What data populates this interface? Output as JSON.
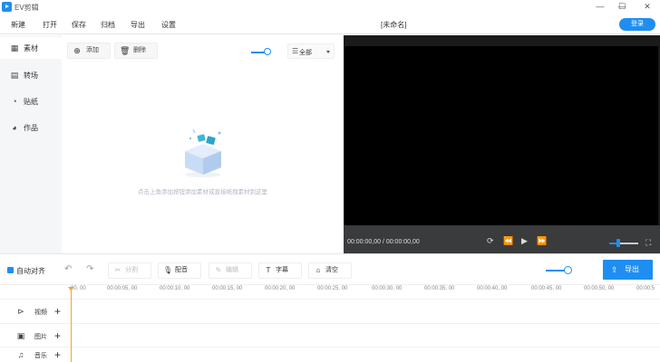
{
  "window": {
    "title": "EV剪辑",
    "controls": {
      "minimize": "—",
      "maximize": "☐",
      "close": "✕"
    }
  },
  "menu": {
    "items": [
      "新建",
      "打开",
      "保存",
      "归档",
      "导出",
      "设置"
    ],
    "doc_title": "[未命名]",
    "login_label": "登录"
  },
  "sidebar": {
    "items": [
      {
        "label": "素材",
        "icon": "grid-icon",
        "active": true
      },
      {
        "label": "转场",
        "icon": "film-icon",
        "active": false
      },
      {
        "label": "贴纸",
        "icon": "sticker-icon",
        "active": false
      },
      {
        "label": "作品",
        "icon": "pie-icon",
        "active": false
      }
    ]
  },
  "library": {
    "add_label": "添加",
    "delete_label": "删除",
    "filter_value": "全部",
    "empty_hint": "点击上角添加按钮添加素材或直接拖拽素材到这里"
  },
  "preview": {
    "time": "00:00:00,00 / 00:00:00,00"
  },
  "timeline": {
    "auto_align_label": "自动对齐",
    "split_label": "分割",
    "dub_label": "配音",
    "edit_label": "编辑",
    "subtitle_label": "字幕",
    "clear_label": "清空",
    "export_label": "导出",
    "ruler_ticks": [
      "00, 00",
      "00:00:05, 00",
      "00:00:10, 00",
      "00:00:15, 00",
      "00:00:20, 00",
      "00:00:25, 00",
      "00:00:30, 00",
      "00:00:35, 00",
      "00:00:40, 00",
      "00:00:45, 00",
      "00:00:50, 00",
      "00:00:5"
    ],
    "tracks": [
      {
        "label": "视频",
        "icon": "video-icon"
      },
      {
        "label": "图片",
        "icon": "image-icon"
      },
      {
        "label": "音乐",
        "icon": "music-icon"
      }
    ]
  },
  "colors": {
    "accent": "#1f8ef2",
    "playhead": "#f5a623",
    "preview_bg": "#000000",
    "preview_bar": "#3a3b3d"
  }
}
